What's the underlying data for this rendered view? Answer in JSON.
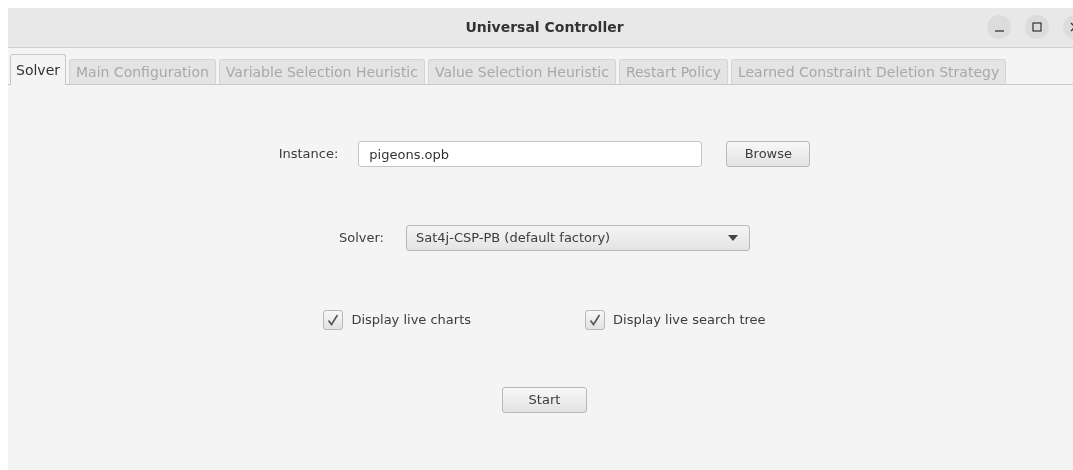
{
  "window": {
    "title": "Universal Controller"
  },
  "tabs": [
    {
      "label": "Solver",
      "selected": true
    },
    {
      "label": "Main Configuration",
      "selected": false
    },
    {
      "label": "Variable Selection Heuristic",
      "selected": false
    },
    {
      "label": "Value Selection Heuristic",
      "selected": false
    },
    {
      "label": "Restart Policy",
      "selected": false
    },
    {
      "label": "Learned Constraint Deletion Strategy",
      "selected": false
    }
  ],
  "instance": {
    "label": "Instance:",
    "value": "pigeons.opb",
    "button": "Browse"
  },
  "solver": {
    "label": "Solver:",
    "value": "Sat4j-CSP-PB (default factory)"
  },
  "options": [
    {
      "label": "Display live charts",
      "checked": true
    },
    {
      "label": "Display live search tree",
      "checked": true
    }
  ],
  "start_button": "Start"
}
